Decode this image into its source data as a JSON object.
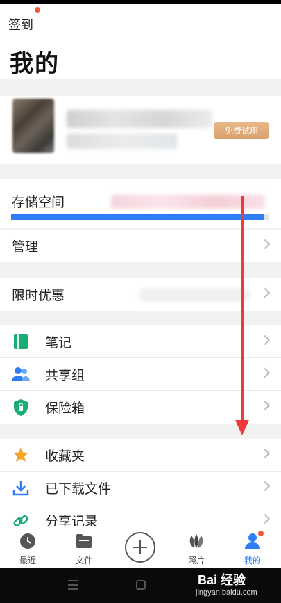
{
  "header": {
    "signin_label": "签到",
    "title": "我的"
  },
  "profile": {
    "trial_button": "免费试用"
  },
  "storage": {
    "label": "存储空间",
    "usage_fraction": 0.98
  },
  "menu_group_1": [
    {
      "label": "管理"
    }
  ],
  "menu_group_2": [
    {
      "label": "限时优惠"
    }
  ],
  "menu_group_3": [
    {
      "label": "笔记",
      "icon": "note-icon"
    },
    {
      "label": "共享组",
      "icon": "share-group-icon"
    },
    {
      "label": "保险箱",
      "icon": "safe-box-icon"
    }
  ],
  "menu_group_4": [
    {
      "label": "收藏夹",
      "icon": "star-icon"
    },
    {
      "label": "已下载文件",
      "icon": "download-icon"
    },
    {
      "label": "分享记录",
      "icon": "link-icon"
    }
  ],
  "tabbar": {
    "recent": "最近",
    "files": "文件",
    "photos": "照片",
    "mine": "我的"
  },
  "watermark": {
    "brand": "Bai 经验",
    "url": "jingyan.baidu.com"
  },
  "colors": {
    "accent": "#2e7df6",
    "badge": "#f25a3a",
    "note_green": "#1aad73",
    "star_orange": "#f5a623",
    "annotation_red": "#ee3a3a"
  }
}
